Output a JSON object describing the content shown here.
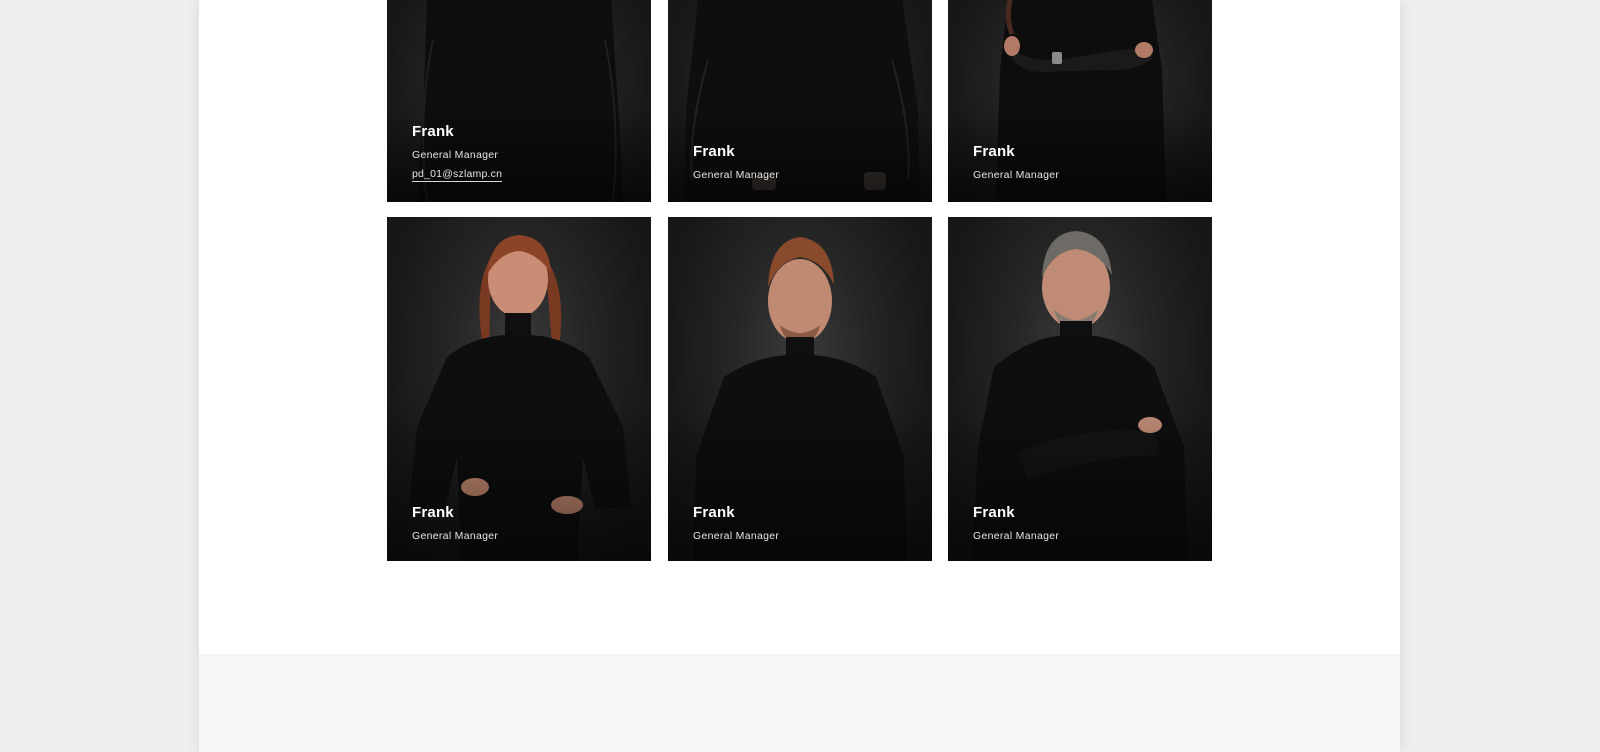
{
  "team": {
    "members": [
      {
        "name": "Frank",
        "title": "General Manager",
        "email": "pd_01@szlamp.cn",
        "photo": "woman-portrait-black-turtleneck"
      },
      {
        "name": "Frank",
        "title": "General Manager",
        "photo": "man-portrait-black-sweater-watch"
      },
      {
        "name": "Frank",
        "title": "General Manager",
        "photo": "woman-portrait-arms-crossed-watch"
      },
      {
        "name": "Frank",
        "title": "General Manager",
        "photo": "woman-portrait-hands-on-hips"
      },
      {
        "name": "Frank",
        "title": "General Manager",
        "photo": "man-portrait-arms-down"
      },
      {
        "name": "Frank",
        "title": "General Manager",
        "photo": "man-portrait-arms-crossed"
      }
    ]
  },
  "colors": {
    "page_background": "#efefef",
    "content_background": "#ffffff",
    "card_background": "#161616",
    "footer_band": "#f5f6f7",
    "text_on_card": "#ffffff"
  }
}
